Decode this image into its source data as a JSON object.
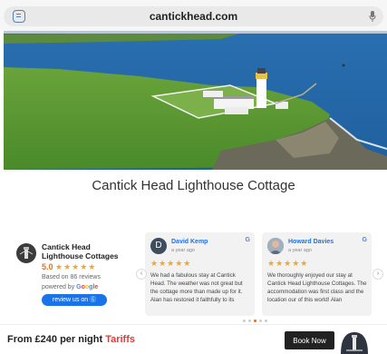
{
  "browser": {
    "url": "cantickhead.com",
    "tab_icon": "tabs-icon",
    "mic_icon": "microphone-icon"
  },
  "hero": {
    "image": "aerial view of a white lighthouse on green cliffs by the sea"
  },
  "page": {
    "title": "Cantick Head Lighthouse Cottage"
  },
  "rating": {
    "business_name": "Cantick Head Lighthouse Cottages",
    "score": "5.0",
    "stars": "★★★★★",
    "based_on": "Based on 86 reviews",
    "powered_by": "powered by",
    "google": [
      "G",
      "o",
      "o",
      "g",
      "l",
      "e"
    ],
    "review_button": "review us on"
  },
  "reviews": [
    {
      "name": "David Kemp",
      "initial": "D",
      "time": "a year ago",
      "stars": "★★★★★",
      "text": "We had a fabulous stay at Cantick Head. The weather was not great but the cottage more than made up for it. Alan has restored it faithfully to its"
    },
    {
      "name": "Howard Davies",
      "time": "a year ago",
      "stars": "★★★★★",
      "text": "We thoroughly enjoyed our stay at Cantick Head Lighthouse Cottages. The accommodation was first class and the location our of this world! Alan"
    }
  ],
  "carousel": {
    "prev": "‹",
    "next": "›",
    "dot_count": 5,
    "active_dot": 2
  },
  "bottom_bar": {
    "price": "From £240 per night",
    "tariffs": "Tariffs",
    "book_now": "Book Now"
  },
  "colors": {
    "accent_blue": "#1a73e8",
    "star": "#f5a623",
    "tariffs_red": "#e53935",
    "book_dark": "#222222"
  }
}
